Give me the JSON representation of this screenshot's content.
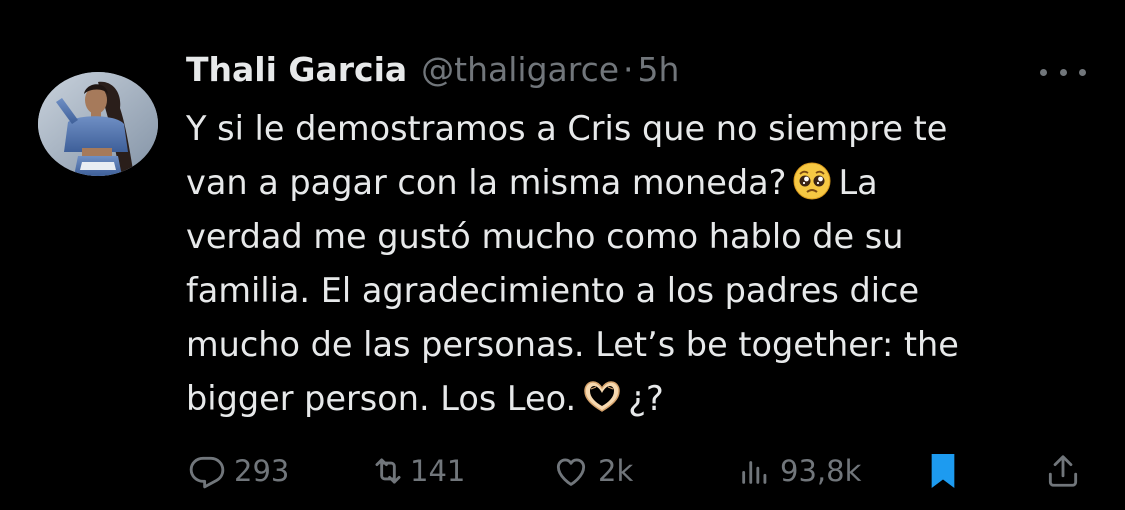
{
  "tweet": {
    "author_name": "Thali Garcia",
    "handle": "@thaligarce",
    "separator": "·",
    "time": "5h",
    "lines": [
      "Y si le demostramos a Cris que no siempre te",
      "van a pagar con la misma moneda?",
      "La",
      "verdad me gustó mucho como hablo de su",
      "familia. El agradecimiento a los padres dice",
      "mucho de las personas. Let’s be together: the",
      "bigger person. Los Leo.",
      "¿?"
    ],
    "emojis": [
      "pleading-face-emoji",
      "heart-hands-emoji"
    ]
  },
  "actions": {
    "replies": "293",
    "retweets": "141",
    "likes": "2k",
    "views": "93,8k"
  },
  "icons": {
    "more": "more-icon",
    "reply": "reply-icon",
    "retweet": "retweet-icon",
    "like": "heart-icon",
    "views": "views-icon",
    "bookmark": "bookmark-icon",
    "share": "share-icon"
  },
  "colors": {
    "background": "#000000",
    "text": "#e7e9ea",
    "secondary": "#71767b",
    "bookmark": "#1d9bf0"
  }
}
